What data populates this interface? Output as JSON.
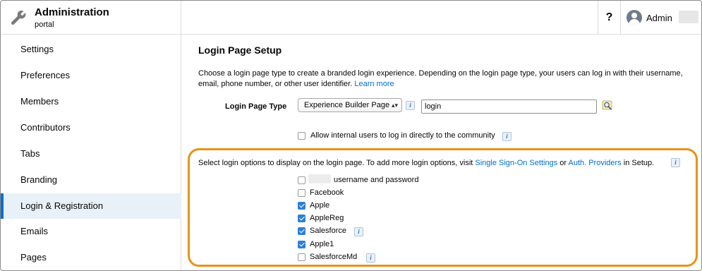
{
  "header": {
    "title": "Administration",
    "subtitle": "portal",
    "help_label": "?",
    "user_label": "Admin"
  },
  "sidebar": {
    "items": [
      {
        "label": "Settings"
      },
      {
        "label": "Preferences"
      },
      {
        "label": "Members"
      },
      {
        "label": "Contributors"
      },
      {
        "label": "Tabs"
      },
      {
        "label": "Branding"
      },
      {
        "label": "Login & Registration",
        "active": true
      },
      {
        "label": "Emails"
      },
      {
        "label": "Pages"
      }
    ]
  },
  "main": {
    "title": "Login Page Setup",
    "description_line1": "Choose a login page type to create a branded login experience. Depending on the login page type, your users can log in with their username,",
    "description_line2": "email, phone number, or other user identifier.",
    "learn_more": "Learn more",
    "login_page_type_label": "Login Page Type",
    "login_page_type_value": "Experience Builder Page",
    "login_page_input_value": "login",
    "allow_internal_label": "Allow internal users to log in directly to the community",
    "allow_internal_checked": false,
    "options_desc_prefix": "Select login options to display on the login page. To add more login options, visit",
    "sso_link": "Single Sign-On Settings",
    "or_text": "or",
    "auth_link": "Auth. Providers",
    "in_setup_text": "in Setup.",
    "info_glyph": "i",
    "select_arrows": "▴▾",
    "login_options": [
      {
        "label": "username and password",
        "checked": false
      },
      {
        "label": "Facebook",
        "checked": false
      },
      {
        "label": "Apple",
        "checked": true
      },
      {
        "label": "AppleReg",
        "checked": true
      },
      {
        "label": "Salesforce",
        "checked": true,
        "info": true
      },
      {
        "label": "Apple1",
        "checked": true
      },
      {
        "label": "SalesforceMd",
        "checked": false,
        "info": true
      }
    ]
  },
  "colors": {
    "link": "#006dcc",
    "accent": "#0070d2",
    "highlight_border": "#e8911c",
    "checkbox_checked": "#2e7fd6"
  },
  "icons": {
    "header": "wrench-icon",
    "user": "avatar-icon",
    "lookup": "lookup-icon",
    "info": "info-icon"
  }
}
